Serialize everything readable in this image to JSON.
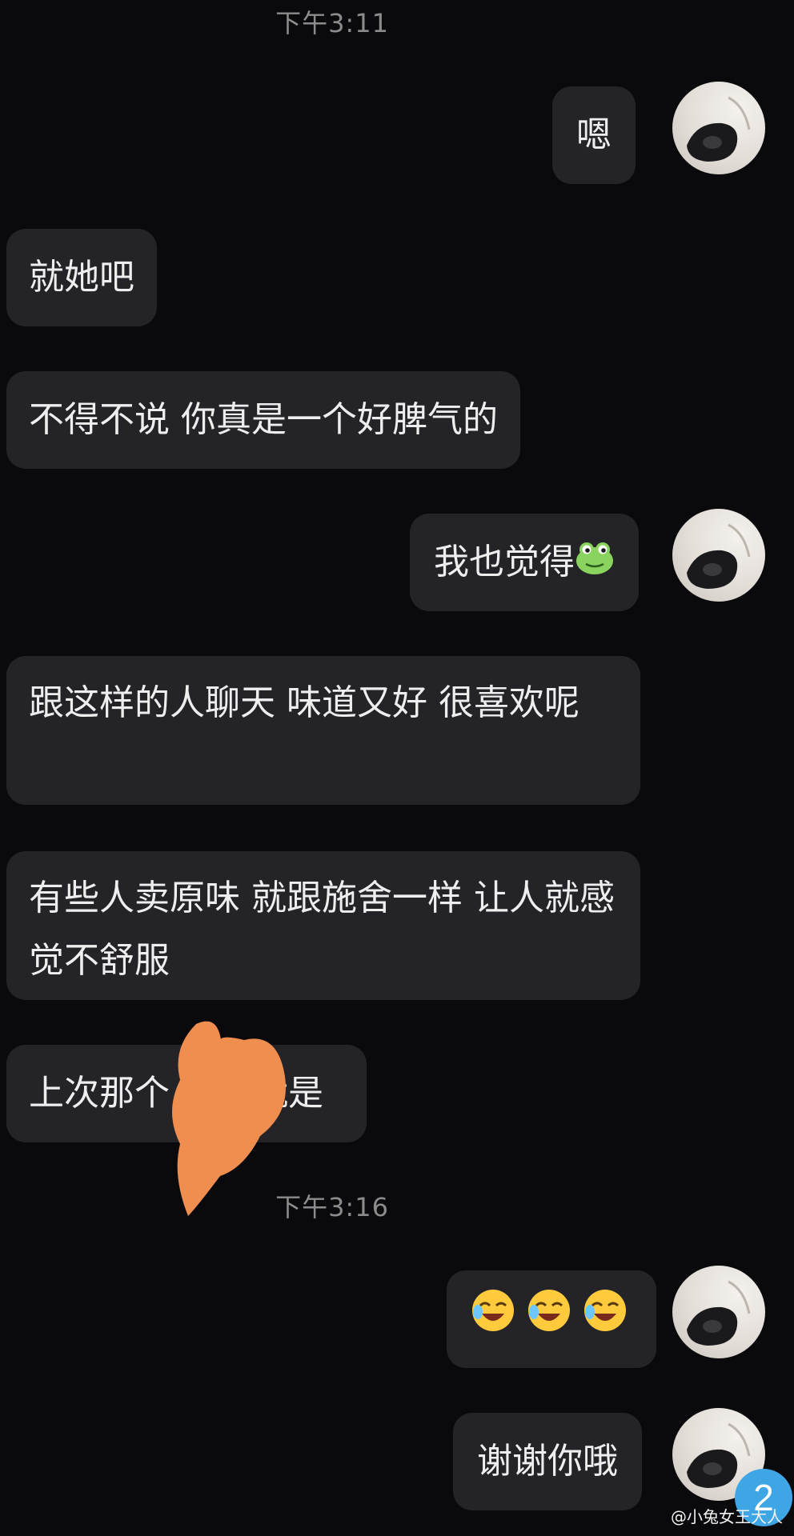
{
  "timestamps": [
    "下午3:11",
    "下午3:16"
  ],
  "messages": [
    {
      "side": "right",
      "text": "嗯"
    },
    {
      "side": "left",
      "text": "就她吧"
    },
    {
      "side": "left",
      "text": "不得不说 你真是一个好脾气的"
    },
    {
      "side": "right",
      "text": "我也觉得",
      "emoji": "frog-face-emoji"
    },
    {
      "side": "left",
      "text": "跟这样的人聊天 味道又好 很喜欢呢"
    },
    {
      "side": "left",
      "text": "有些人卖原味 就跟施舍一样 让人就感觉不舒服"
    },
    {
      "side": "left",
      "text_before": "上次那个",
      "text_after": "就是",
      "redacted": true
    },
    {
      "side": "right",
      "emoji": "tears-of-joy-emoji",
      "count": 3
    },
    {
      "side": "right",
      "text": "谢谢你哦"
    }
  ],
  "unread_badge": "2",
  "watermark": "@小兔女王大人",
  "colors": {
    "background": "#0a0a0d",
    "bubble": "#242428",
    "timestamp": "#8c8c8c",
    "censor_scribble": "#ef8e4f",
    "badge": "#3fa6e6"
  }
}
